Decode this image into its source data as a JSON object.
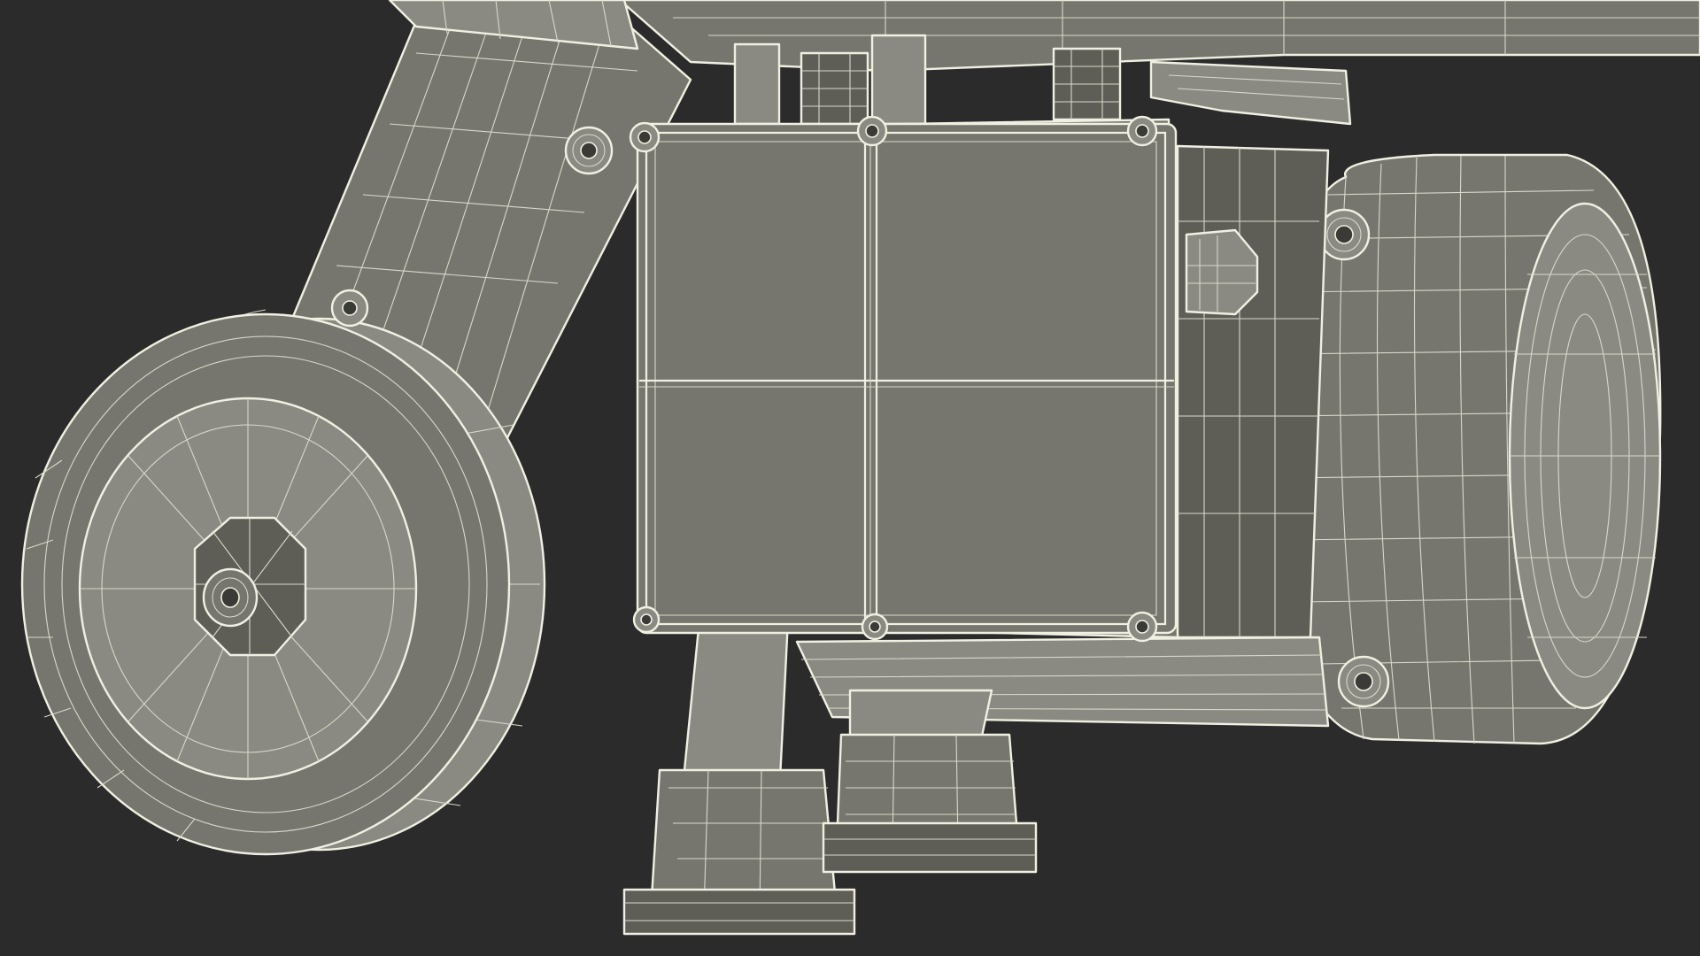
{
  "scene": {
    "subject": "wireframe-3d-render",
    "colors": {
      "background": "#2b2b2b",
      "surface": "#76766e",
      "surface_light": "#8a8a82",
      "surface_dark": "#5e5e57",
      "wire": "#d8d8c8",
      "edge": "#f0f0e2",
      "shadow": "#3a3a36"
    }
  }
}
